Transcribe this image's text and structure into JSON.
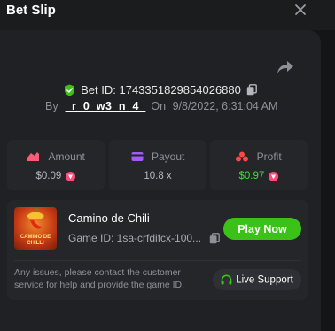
{
  "header": {
    "title": "Bet Slip"
  },
  "bet": {
    "id_label": "Bet ID: 1743351829854026880",
    "by_label": "By",
    "user": "_r_0_w3_n_4_",
    "on_label": "On",
    "datetime": "9/8/2022, 6:31:04 AM"
  },
  "stats": {
    "amount": {
      "label": "Amount",
      "value": "$0.09"
    },
    "payout": {
      "label": "Payout",
      "value": "10.8 x"
    },
    "profit": {
      "label": "Profit",
      "value": "$0.97"
    }
  },
  "game": {
    "name": "Camino de Chili",
    "id_text": "Game ID: 1sa-crfdifcx-100...",
    "play_label": "Play Now",
    "thumb_text": "CAMINO DE CHILLI",
    "notice": "Any issues, please contact the customer service for help and provide the game ID.",
    "support_label": "Live Support"
  },
  "colors": {
    "accent_green": "#3bc117",
    "profit_green": "#4fd44a",
    "coin_pink": "#ff4a7a",
    "amount_icon": "#ff5a78",
    "payout_icon": "#a25cf5",
    "profit_icon": "#ff4545"
  },
  "icons": {
    "close": "close-icon",
    "share": "share-icon",
    "verified": "shield-check-icon",
    "copy": "copy-icon",
    "amount": "amount-icon",
    "payout": "payout-icon",
    "profit": "profit-icon",
    "coin": "coin-icon",
    "support": "headset-icon"
  }
}
